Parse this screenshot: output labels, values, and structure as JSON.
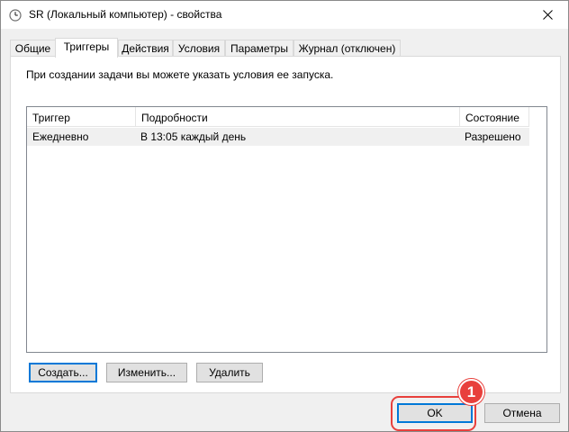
{
  "window": {
    "title": "SR (Локальный компьютер) - свойства",
    "icon": "task-scheduler-clock-icon",
    "close_icon": "close-icon"
  },
  "tabs": [
    {
      "label": "Общие",
      "active": false
    },
    {
      "label": "Триггеры",
      "active": true
    },
    {
      "label": "Действия",
      "active": false
    },
    {
      "label": "Условия",
      "active": false
    },
    {
      "label": "Параметры",
      "active": false
    },
    {
      "label": "Журнал (отключен)",
      "active": false
    }
  ],
  "triggers_tab": {
    "intro_text": "При создании задачи вы можете указать условия ее запуска.",
    "columns": [
      "Триггер",
      "Подробности",
      "Состояние"
    ],
    "rows": [
      {
        "trigger": "Ежедневно",
        "details": "В 13:05 каждый день",
        "status": "Разрешено"
      }
    ],
    "buttons": {
      "create": "Создать...",
      "edit": "Изменить...",
      "delete": "Удалить"
    }
  },
  "footer": {
    "ok": "OK",
    "cancel": "Отмена"
  },
  "annotation": {
    "marker_label": "1",
    "color": "#e8403c"
  },
  "colors": {
    "accent": "#0078d7",
    "annotation": "#e8403c",
    "selected_row": "#f0f0f0"
  }
}
